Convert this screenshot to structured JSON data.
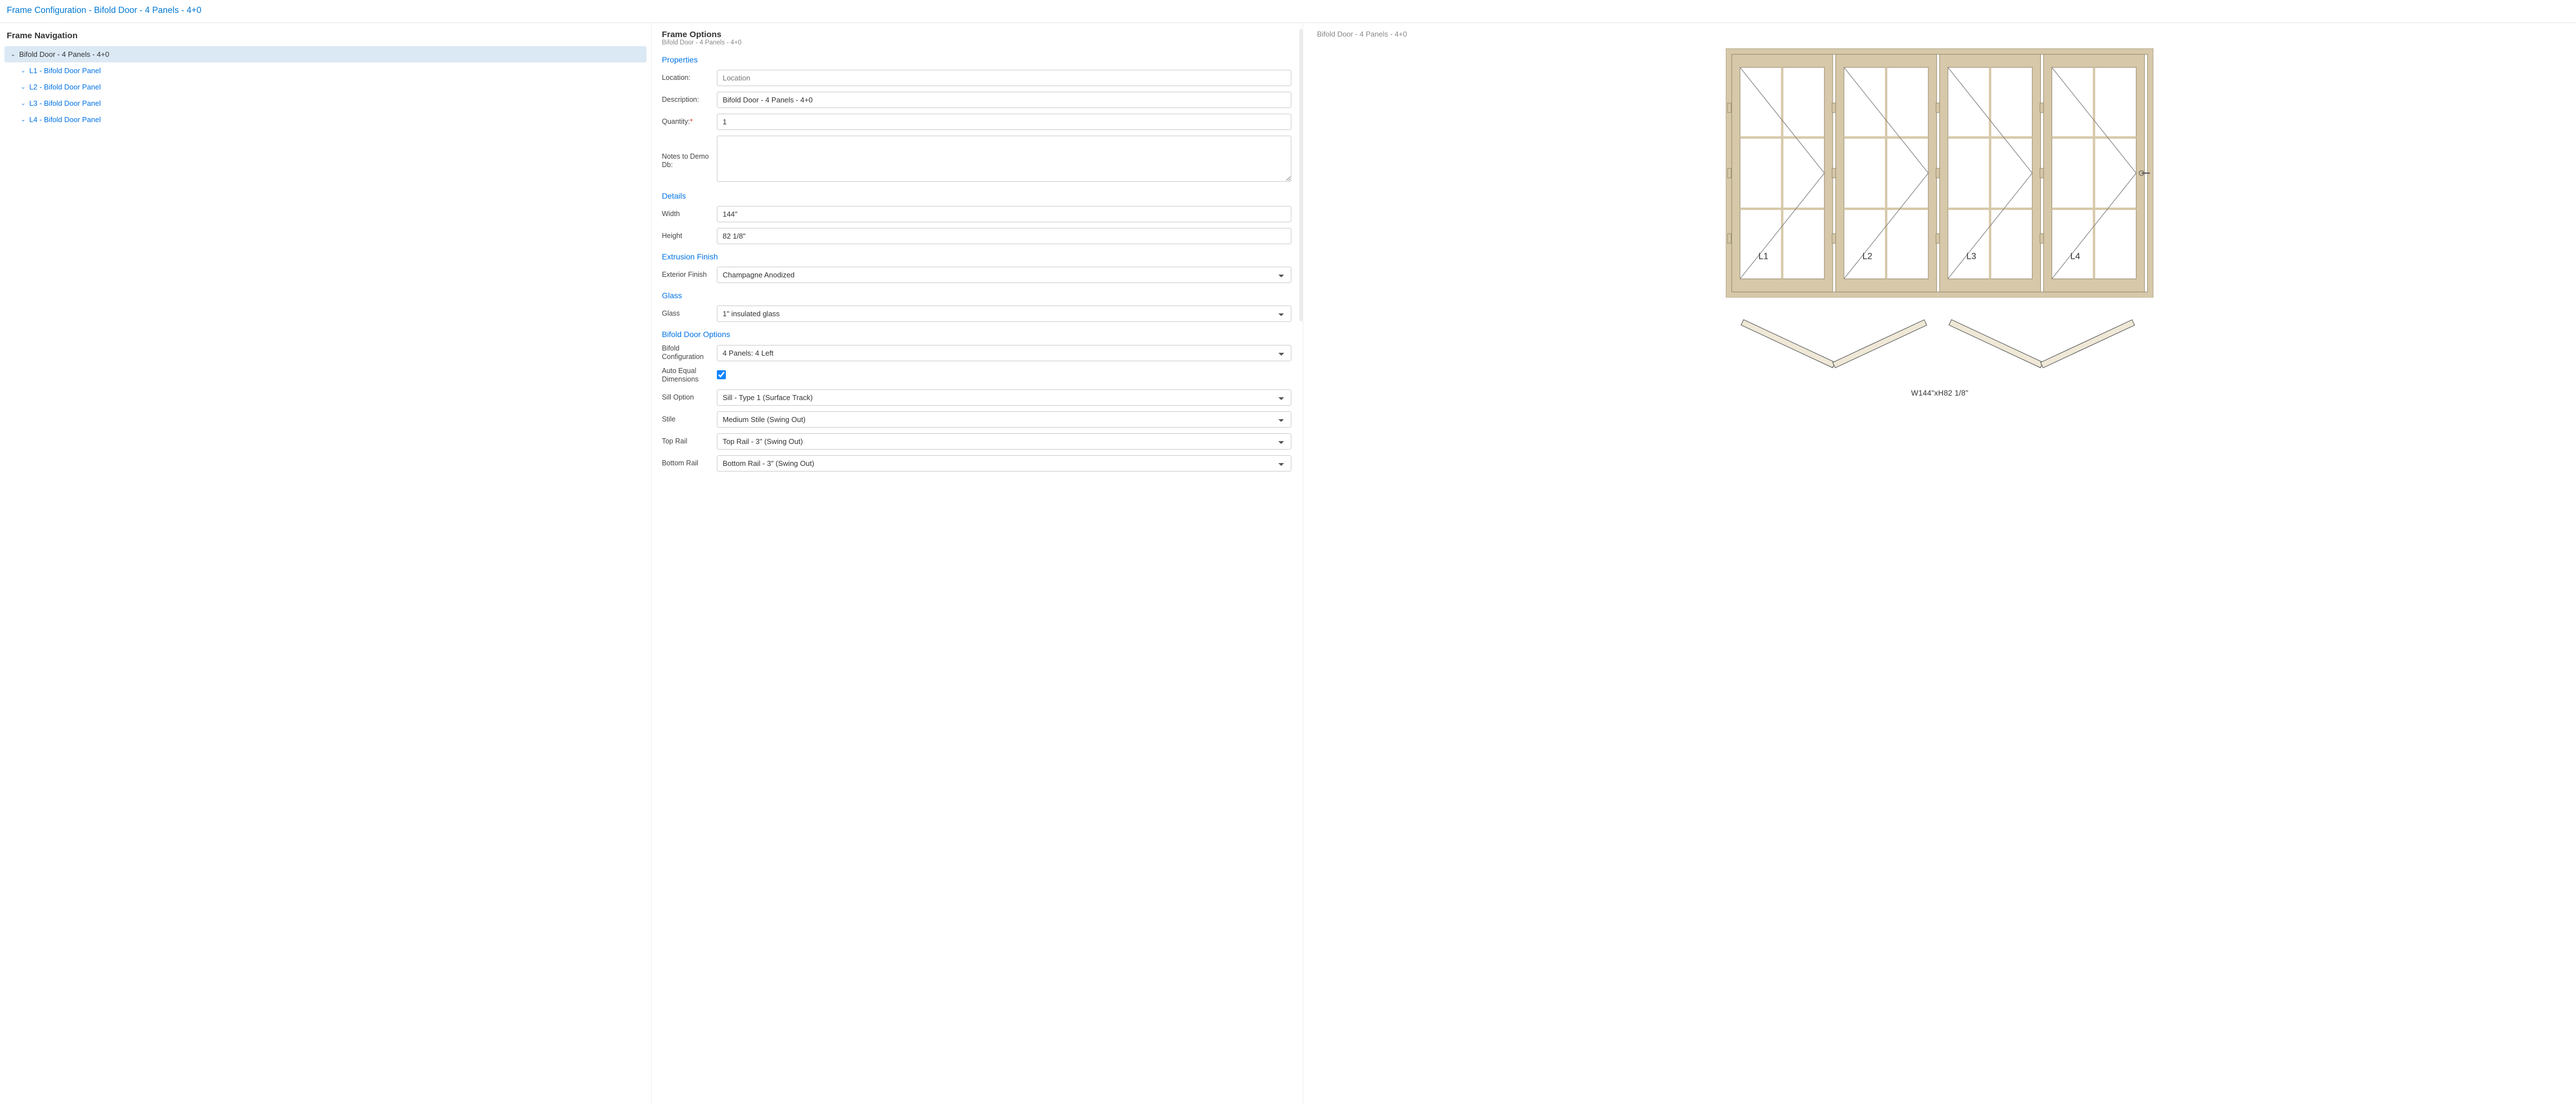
{
  "page": {
    "title_prefix": "Frame Configuration",
    "product_name": "Bifold Door - 4 Panels - 4+0"
  },
  "nav": {
    "heading": "Frame Navigation",
    "root": {
      "label": "Bifold Door - 4 Panels - 4+0"
    },
    "children": [
      {
        "label": "L1 - Bifold Door Panel"
      },
      {
        "label": "L2 - Bifold Door Panel"
      },
      {
        "label": "L3 - Bifold Door Panel"
      },
      {
        "label": "L4 - Bifold Door Panel"
      }
    ]
  },
  "form": {
    "heading": "Frame Options",
    "subheading": "Bifold Door - 4 Panels - 4+0",
    "sections": {
      "properties": "Properties",
      "details": "Details",
      "extrusion": "Extrusion Finish",
      "glass": "Glass",
      "bifold": "Bifold Door Options"
    },
    "labels": {
      "location": "Location:",
      "description": "Description:",
      "quantity": "Quantity:",
      "notes": "Notes to Demo Db:",
      "width": "Width",
      "height": "Height",
      "ext_finish": "Exterior Finish",
      "glass": "Glass",
      "bifold_cfg": "Bifold Configuration",
      "auto_eq": "Auto Equal Dimensions",
      "sill": "Sill Option",
      "stile": "Stile",
      "top_rail": "Top Rail",
      "bottom_rail": "Bottom Rail"
    },
    "values": {
      "location": "",
      "location_placeholder": "Location",
      "description": "Bifold Door - 4 Panels - 4+0",
      "quantity": "1",
      "notes": "",
      "width": "144\"",
      "height": "82 1/8\"",
      "ext_finish": "Champagne Anodized",
      "glass": "1\" insulated glass",
      "bifold_cfg": "4 Panels: 4 Left",
      "auto_eq": true,
      "sill": "Sill - Type 1 (Surface Track)",
      "stile": "Medium Stile (Swing Out)",
      "top_rail": "Top Rail - 3\" (Swing Out)",
      "bottom_rail": "Bottom Rail - 3\" (Swing Out)"
    }
  },
  "preview": {
    "breadcrumb": "Bifold Door - 4 Panels - 4+0",
    "panel_labels": [
      "L1",
      "L2",
      "L3",
      "L4"
    ],
    "dimension_text": "W144\"xH82 1/8\"",
    "colors": {
      "frame": "#d6c8a9",
      "frame_stroke": "#9b8f74",
      "line": "#666"
    }
  }
}
